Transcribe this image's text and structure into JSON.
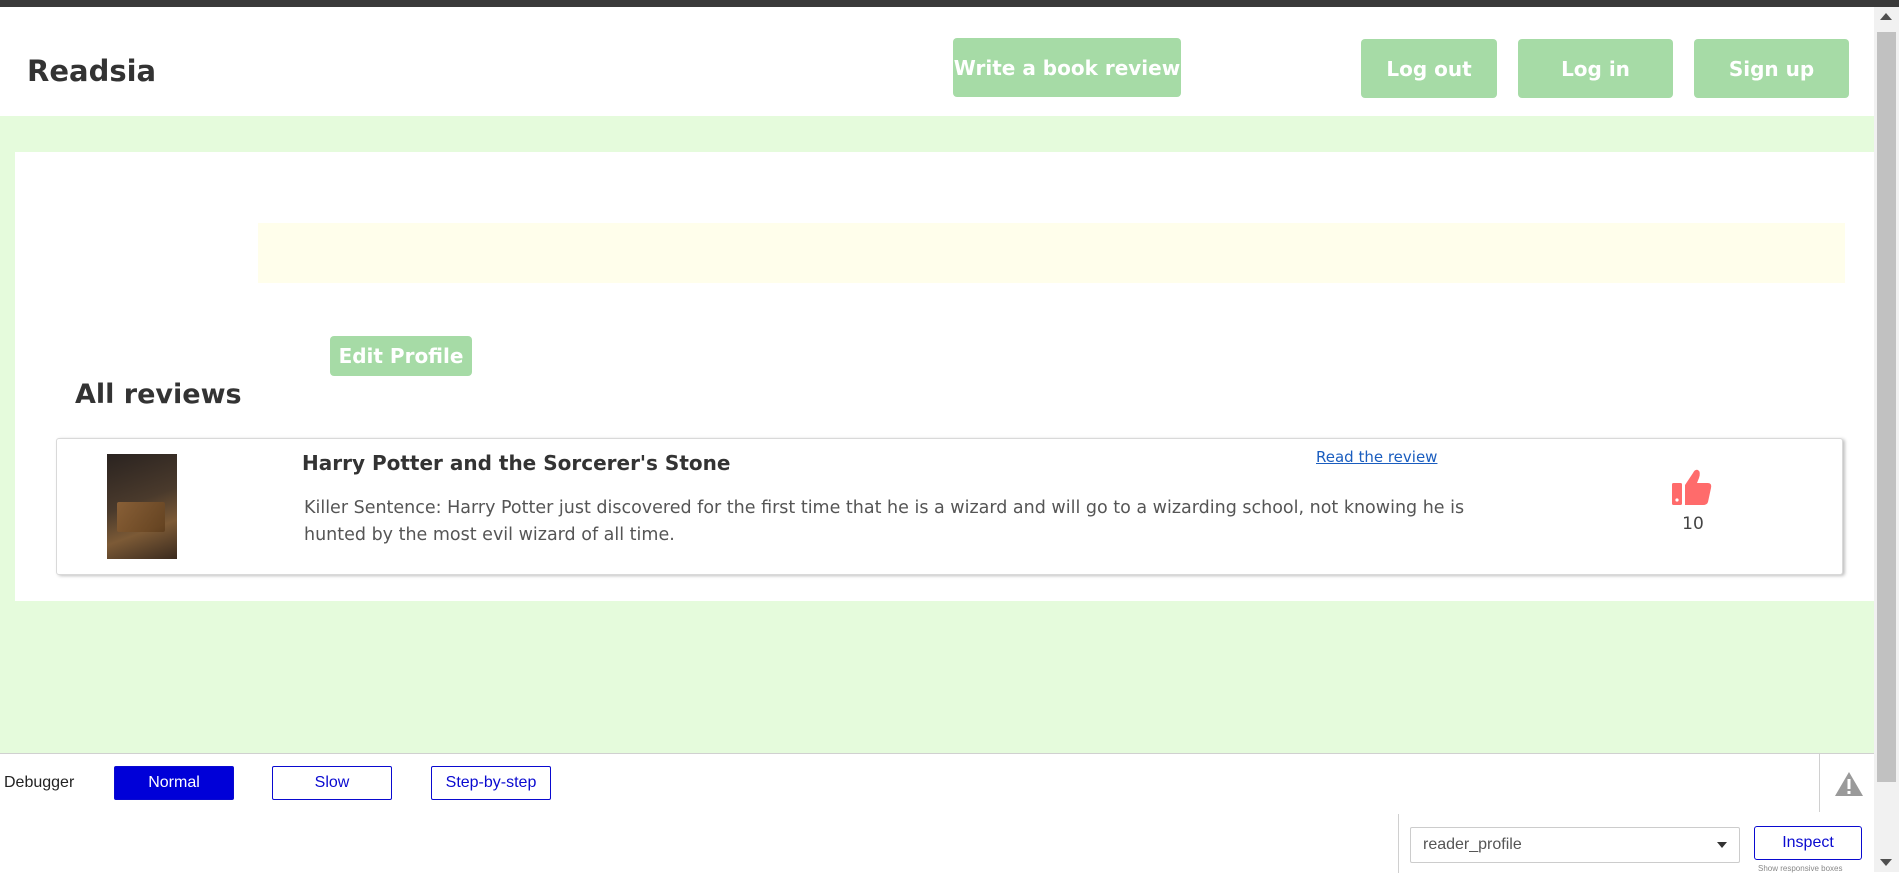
{
  "header": {
    "brand": "Readsia",
    "write_review": "Write a book review",
    "logout": "Log out",
    "login": "Log in",
    "signup": "Sign up"
  },
  "profile": {
    "edit_button": "Edit Profile"
  },
  "reviews": {
    "title": "All reviews",
    "items": [
      {
        "book_title": "Harry Potter and the Sorcerer's Stone",
        "link": "Read the review",
        "excerpt": "Killer Sentence:  Harry Potter just discovered for the first time that he is a wizard and will go to a wizarding school, not knowing he is hunted by the most evil wizard of all time.",
        "likes": "10",
        "like_icon": "thumbs-up-icon"
      }
    ]
  },
  "debugger": {
    "label": "Debugger",
    "modes": [
      "Normal",
      "Slow",
      "Step-by-step"
    ],
    "active_mode": "Normal",
    "page_select": "reader_profile",
    "inspect": "Inspect",
    "responsive_hint": "Show responsive boxes"
  },
  "colors": {
    "brand_green": "#a6dba6",
    "page_bg": "#e5fbdc",
    "bio_bg": "#fffeeb",
    "like": "#ff6b6b",
    "debug_blue": "#0000d8"
  }
}
